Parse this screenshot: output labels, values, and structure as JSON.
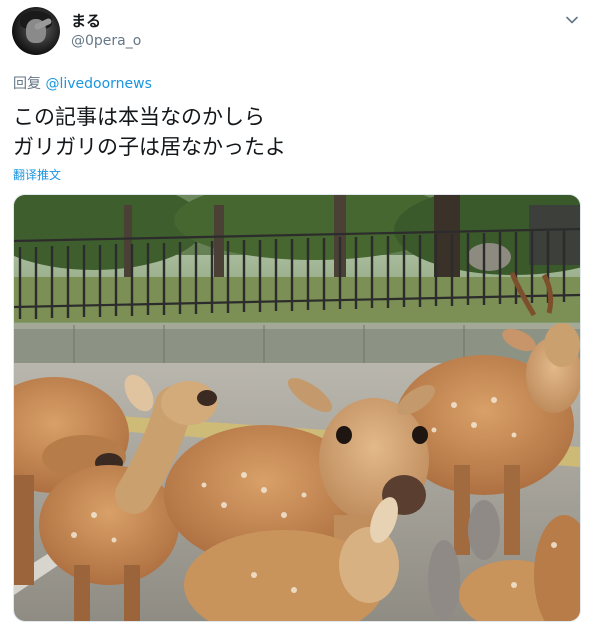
{
  "user": {
    "display_name": "まる",
    "handle": "@0pera_o"
  },
  "reply": {
    "prefix": "回复",
    "mention": "@livedoornews"
  },
  "tweet": {
    "line1": "この記事は本当なのかしら",
    "line2": "ガリガリの子は居なかったよ"
  },
  "translate_label": "翻译推文",
  "icons": {
    "caret": "chevron-down-icon",
    "avatar": "user-avatar"
  },
  "colors": {
    "link": "#1b95e0",
    "secondary": "#657786",
    "text": "#14171a"
  }
}
